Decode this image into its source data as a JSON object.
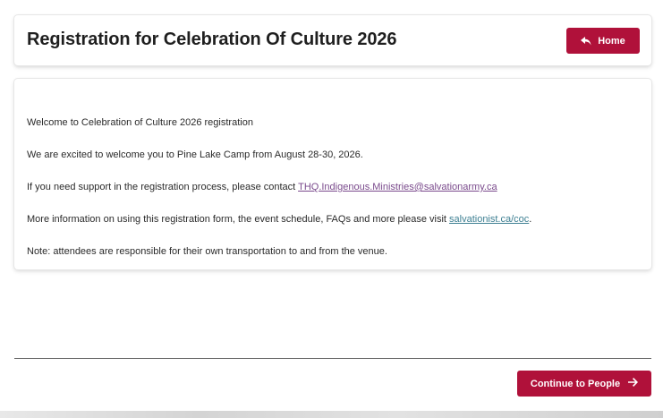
{
  "header": {
    "title": "Registration for Celebration Of Culture 2026",
    "home_button": {
      "label": "Home",
      "icon": "reply-arrow-icon"
    }
  },
  "content": {
    "welcome": "Welcome to Celebration of Culture 2026 registration",
    "excited": "We are excited to welcome you to Pine Lake Camp from August 28-30, 2026.",
    "support_prefix": "If you need support in the registration process, please contact ",
    "support_email": "THQ.Indigenous.Ministries@salvationarmy.ca",
    "info_prefix": "More information on using this registration form, the event schedule, FAQs and more please visit ",
    "info_link": "salvationist.ca/coc",
    "info_suffix": ".",
    "note": "Note: attendees are responsible for their own transportation to and from the venue."
  },
  "footer": {
    "continue_button": {
      "label": "Continue to People",
      "icon": "arrow-right-icon"
    }
  },
  "colors": {
    "accent": "#b0113a",
    "email_link": "#7a4a8c",
    "site_link": "#3d7f92"
  }
}
